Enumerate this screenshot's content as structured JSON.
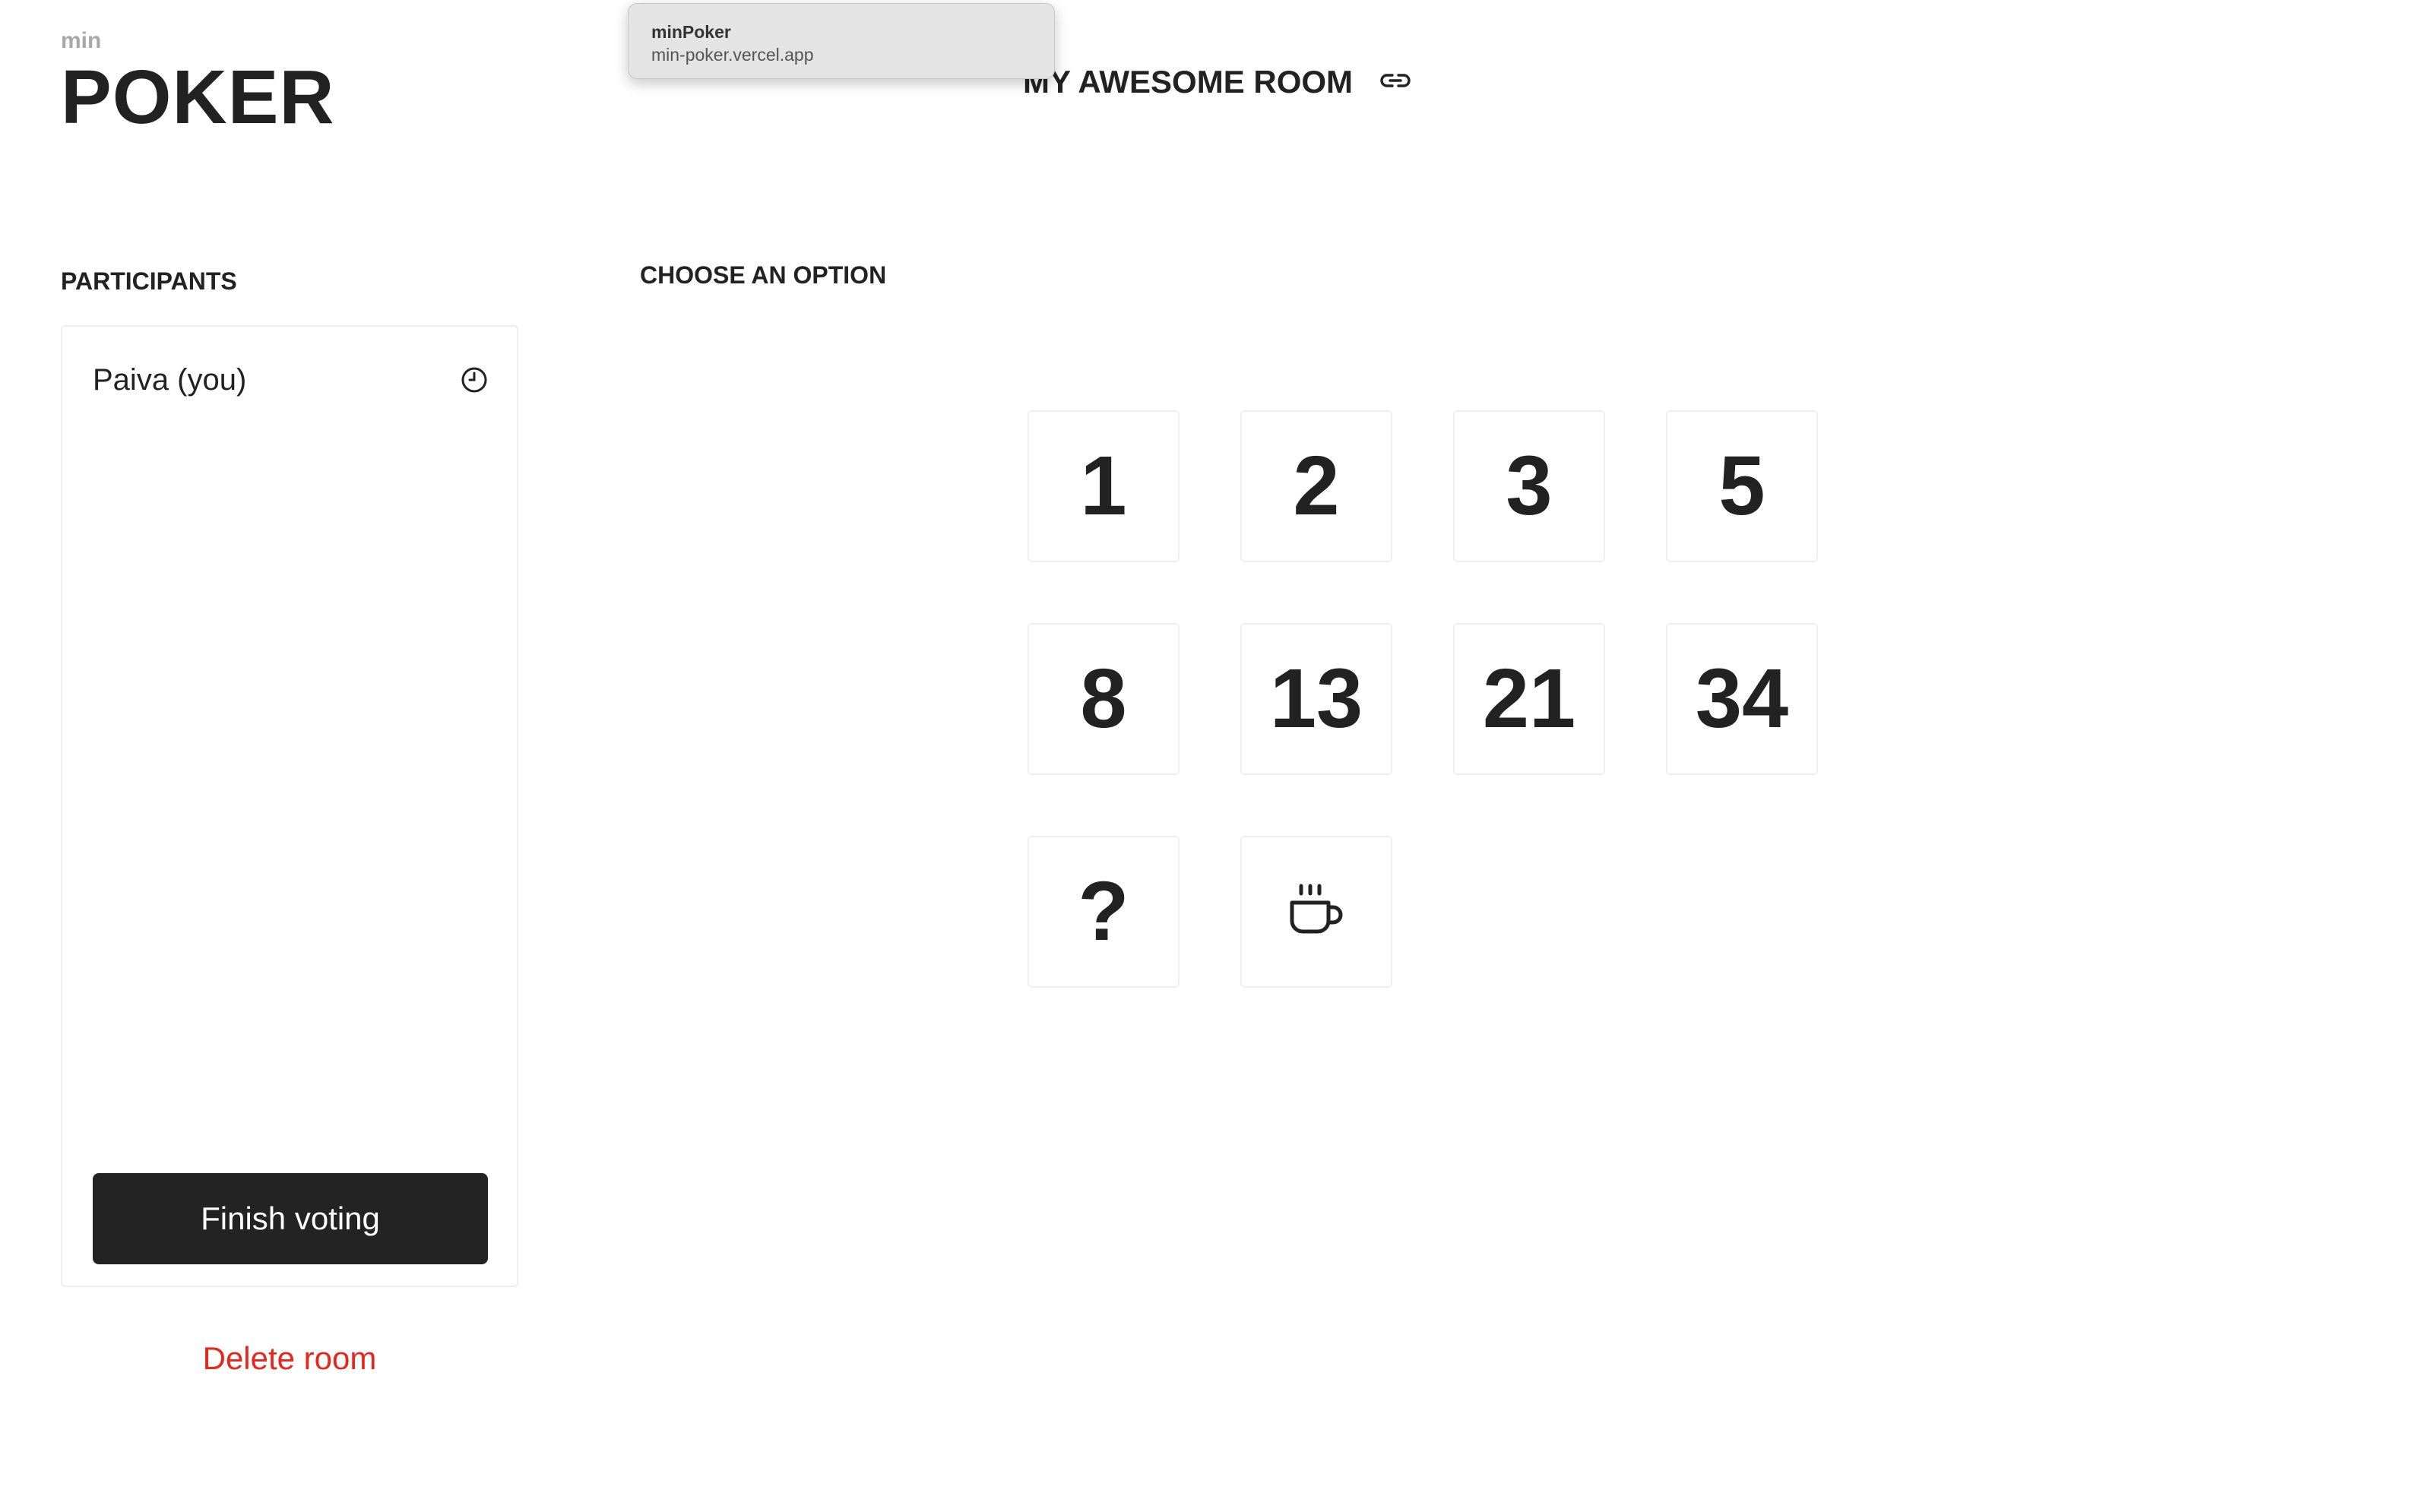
{
  "logo": {
    "small": "min",
    "big": "POKER"
  },
  "tooltip": {
    "title": "minPoker",
    "url": "min-poker.vercel.app"
  },
  "room": {
    "title": "MY AWESOME ROOM",
    "link_icon": "link-icon"
  },
  "participants": {
    "heading": "PARTICIPANTS",
    "items": [
      {
        "name": "Paiva (you)",
        "status_icon": "clock-icon"
      }
    ],
    "finish_button": "Finish voting"
  },
  "delete_room": "Delete room",
  "options": {
    "heading": "CHOOSE AN OPTION",
    "cards": [
      {
        "label": "1"
      },
      {
        "label": "2"
      },
      {
        "label": "3"
      },
      {
        "label": "5"
      },
      {
        "label": "8"
      },
      {
        "label": "13"
      },
      {
        "label": "21"
      },
      {
        "label": "34"
      },
      {
        "label": "?"
      },
      {
        "icon": "coffee-icon"
      }
    ]
  },
  "colors": {
    "text": "#222222",
    "logo_small": "#a8a8a8",
    "button_bg": "#232323",
    "danger": "#e8261c",
    "card_border": "#efefef"
  }
}
